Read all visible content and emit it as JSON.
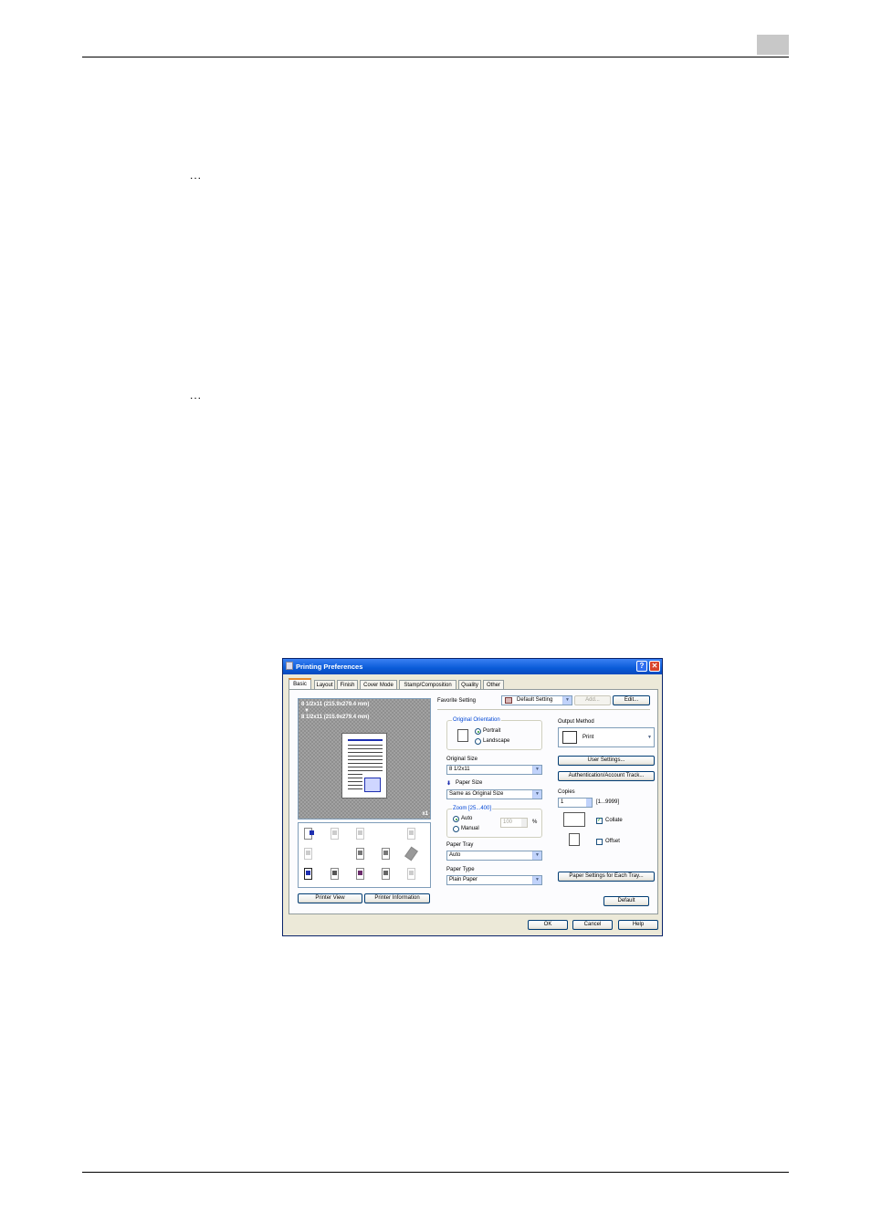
{
  "page": {
    "bullet1": "...",
    "bullet2": "..."
  },
  "dialog": {
    "title": "Printing Preferences",
    "help_glyph": "?",
    "close_glyph": "✕",
    "tabs": [
      "Basic",
      "Layout",
      "Finish",
      "Cover Mode",
      "Stamp/Composition",
      "Quality",
      "Other"
    ],
    "active_tab": "Basic",
    "preview": {
      "line1": "8 1/2x11 (215.9x279.4 mm)",
      "arrow": "▼",
      "line2": "8 1/2x11 (215.9x279.4 mm)",
      "scale": "x1"
    },
    "printer_view_label": "Printer View",
    "printer_information_label": "Printer Information",
    "favorite_setting": {
      "label": "Favorite Setting",
      "value": "Default Setting",
      "add_label": "Add...",
      "edit_label": "Edit..."
    },
    "original_orientation": {
      "title": "Original Orientation",
      "portrait": "Portrait",
      "landscape": "Landscape",
      "selected": "Portrait"
    },
    "original_size": {
      "label": "Original Size",
      "value": "8 1/2x11"
    },
    "paper_size": {
      "label": "Paper Size",
      "value": "Same as Original Size"
    },
    "zoom": {
      "title": "Zoom [25...400]",
      "auto": "Auto",
      "manual": "Manual",
      "value": "100",
      "unit": "%",
      "selected": "Auto"
    },
    "paper_tray": {
      "label": "Paper Tray",
      "value": "Auto"
    },
    "paper_type": {
      "label": "Paper Type",
      "value": "Plain Paper"
    },
    "output_method": {
      "label": "Output Method",
      "value": "Print"
    },
    "user_settings_label": "User Settings...",
    "authentication_label": "Authentication/Account Track...",
    "copies": {
      "label": "Copies",
      "value": "1",
      "range": "[1...9999]"
    },
    "collate": {
      "label": "Collate",
      "checked": true
    },
    "offset": {
      "label": "Offset",
      "checked": false
    },
    "paper_settings_label": "Paper Settings for Each Tray...",
    "default_label": "Default",
    "ok_label": "OK",
    "cancel_label": "Cancel",
    "help_label": "Help",
    "colors": {
      "titlebar": "#0a5bd8",
      "accent_tab": "#e68b2c",
      "group_title": "#0046d5"
    }
  }
}
